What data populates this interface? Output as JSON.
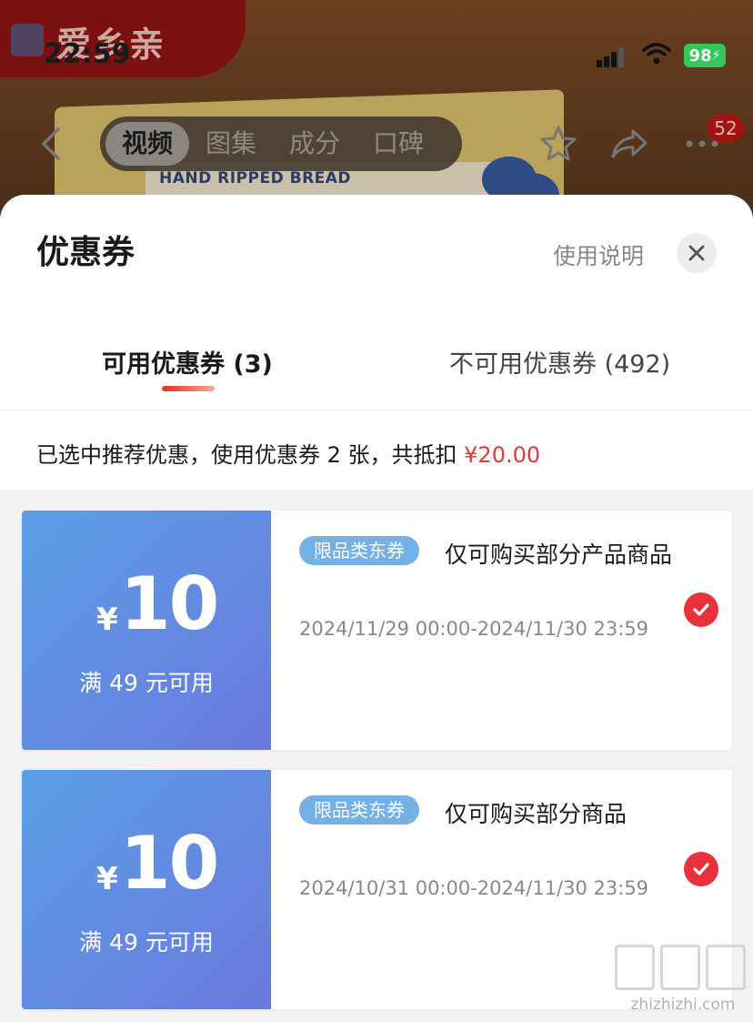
{
  "status_bar": {
    "time": "22:59",
    "battery": "98"
  },
  "brand": {
    "name": "爱乡亲"
  },
  "product": {
    "box_text": "HAND RIPPED BREAD"
  },
  "nav": {
    "tabs": [
      "视频",
      "图集",
      "成分",
      "口碑"
    ],
    "active_tab": "视频",
    "more_badge": "52"
  },
  "sheet": {
    "title": "优惠券",
    "usage_link": "使用说明",
    "tabs": [
      {
        "label": "可用优惠券 (3)",
        "active": true
      },
      {
        "label": "不可用优惠券 (492)",
        "active": false
      }
    ],
    "summary_prefix": "已选中推荐优惠，使用优惠券 2 张，共抵扣 ",
    "summary_amount": "¥20.00"
  },
  "coupons": [
    {
      "currency": "¥",
      "value": "10",
      "min_spend": "满 49 元可用",
      "badge": "限品类东券",
      "description": "仅可购买部分产品商品",
      "validity": "2024/11/29 00:00-2024/11/30 23:59",
      "selected": true
    },
    {
      "currency": "¥",
      "value": "10",
      "min_spend": "满 49 元可用",
      "badge": "限品类东券",
      "description": "仅可购买部分商品",
      "validity": "2024/10/31 00:00-2024/11/30 23:59",
      "selected": true
    }
  ],
  "watermark": {
    "url": "zhizhizhi.com"
  },
  "colors": {
    "accent_red": "#e4393c",
    "coupon_blue": "#5b9fe6",
    "badge_blue": "#75b0e6",
    "check_red": "#e8323b"
  }
}
